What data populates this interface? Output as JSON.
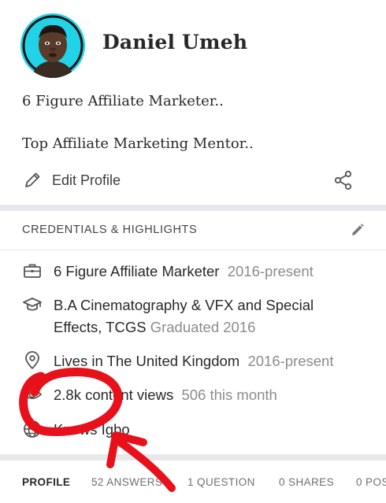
{
  "profile": {
    "name": "Daniel Umeh",
    "bio_line1": "6 Figure Affiliate Marketer..",
    "bio_line2": "Top Affiliate Marketing Mentor..",
    "edit_label": "Edit Profile"
  },
  "credentials": {
    "heading": "CREDENTIALS & HIGHLIGHTS",
    "items": [
      {
        "icon": "briefcase-icon",
        "text": "6 Figure Affiliate Marketer",
        "meta": "2016-present"
      },
      {
        "icon": "graduation-cap-icon",
        "text": "B.A Cinematography & VFX and Special",
        "text2": "Effects, TCGS",
        "meta": "Graduated 2016"
      },
      {
        "icon": "location-pin-icon",
        "text": "Lives in The United Kingdom",
        "meta": "2016-present"
      },
      {
        "icon": "eye-icon",
        "text": "2.8k content views",
        "meta": "506 this month"
      },
      {
        "icon": "globe-icon",
        "text": "Knows Igbo"
      }
    ]
  },
  "tabs": [
    "PROFILE",
    "52 ANSWERS",
    "1 QUESTION",
    "0 SHARES",
    "0 POS"
  ],
  "colors": {
    "avatar_bg": "#22d3e8",
    "annotation_red": "#e8101a",
    "muted": "#8c8c8c"
  }
}
